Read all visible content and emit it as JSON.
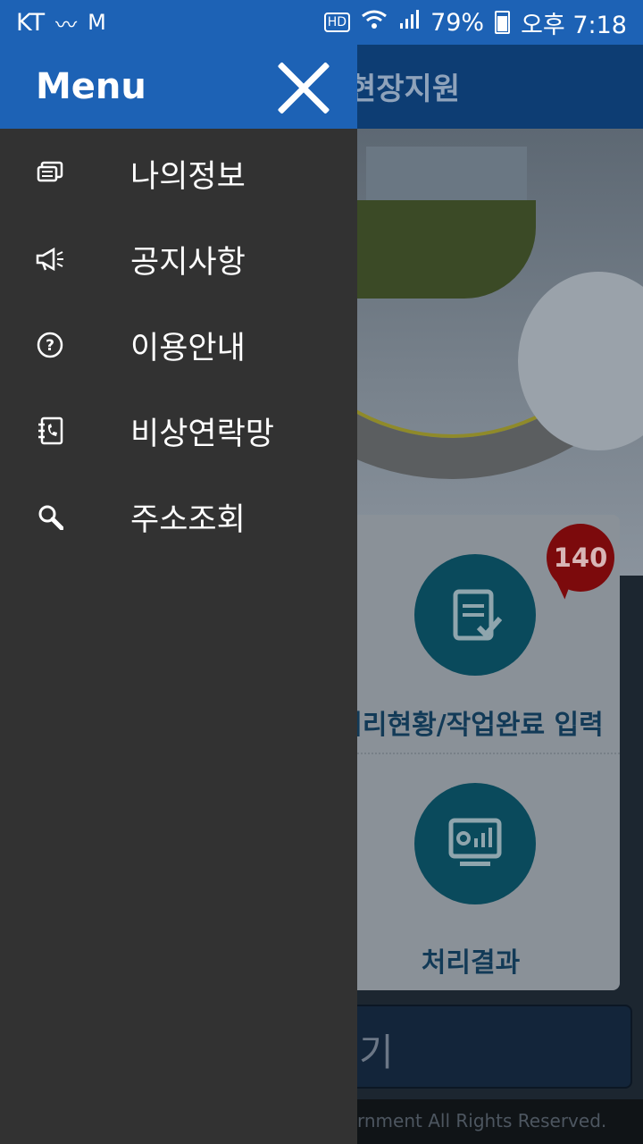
{
  "status_bar": {
    "carrier": "KT",
    "battery": "79%",
    "time": "오후 7:18",
    "hd_label": "HD"
  },
  "app": {
    "title_partial": "현장지원",
    "badge_count": "140",
    "card_items": [
      {
        "label": "처리현황/작업완료 입력",
        "icon": "clipboard-check-icon"
      },
      {
        "label": "처리결과",
        "icon": "monitor-chart-icon"
      }
    ],
    "bottom_button_partial": "기",
    "footer_partial": "rnment All Rights Reserved."
  },
  "drawer": {
    "title": "Menu",
    "items": [
      {
        "label": "나의정보",
        "icon": "chat-icon"
      },
      {
        "label": "공지사항",
        "icon": "megaphone-icon"
      },
      {
        "label": "이용안내",
        "icon": "help-icon"
      },
      {
        "label": "비상연락망",
        "icon": "phonebook-icon"
      },
      {
        "label": "주소조회",
        "icon": "search-icon"
      }
    ]
  },
  "colors": {
    "drawer_header": "#1d62b5",
    "drawer_bg": "#323232",
    "badge": "#c8181c"
  }
}
